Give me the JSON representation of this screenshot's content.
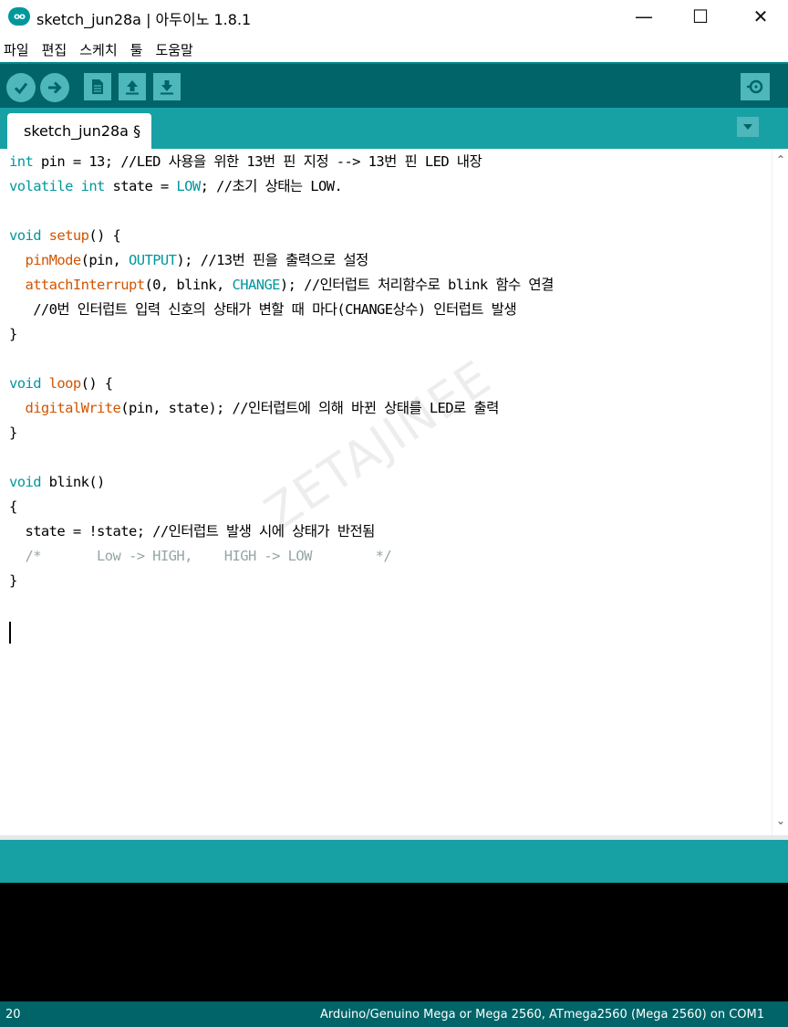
{
  "window": {
    "title": "sketch_jun28a | 아두이노 1.8.1",
    "minimize": "—",
    "maximize": "☐",
    "close": "✕",
    "logo_text": "oo"
  },
  "menu": [
    "파일",
    "편집",
    "스케치",
    "툴",
    "도움말"
  ],
  "toolbar": {
    "buttons": [
      "verify-icon",
      "upload-icon",
      "new-icon",
      "open-icon",
      "save-icon",
      "serial-monitor-icon"
    ]
  },
  "tab": {
    "label": "sketch_jun28a §"
  },
  "code": {
    "l1": {
      "a": "int",
      "b": " pin = 13; //LED 사용을 위한 13번 핀 지정 --> 13번 핀 LED 내장"
    },
    "l2": {
      "a": "volatile",
      "b": " ",
      "c": "int",
      "d": " state = ",
      "e": "LOW",
      "f": "; //초기 상태는 LOW."
    },
    "l4": {
      "a": "void",
      "b": " ",
      "c": "setup",
      "d": "() {"
    },
    "l5": {
      "a": "  ",
      "b": "pinMode",
      "c": "(pin, ",
      "d": "OUTPUT",
      "e": "); //13번 핀을 출력으로 설정"
    },
    "l6": {
      "a": "  ",
      "b": "attachInterrupt",
      "c": "(0, blink, ",
      "d": "CHANGE",
      "e": "); //인터럽트 처리함수로 blink 함수 연결"
    },
    "l7": {
      "a": "   //0번 인터럽트 입력 신호의 상태가 변할 때 마다(CHANGE상수) 인터럽트 발생"
    },
    "l8": {
      "a": "}"
    },
    "l10": {
      "a": "void",
      "b": " ",
      "c": "loop",
      "d": "() {"
    },
    "l11": {
      "a": "  ",
      "b": "digitalWrite",
      "c": "(pin, state); //인터럽트에 의해 바뀐 상태를 LED로 출력"
    },
    "l12": {
      "a": "}"
    },
    "l14": {
      "a": "void",
      "b": " blink()"
    },
    "l15": {
      "a": "{"
    },
    "l16": {
      "a": "  state = !state; //인터럽트 발생 시에 상태가 반전됨"
    },
    "l17": {
      "a": "  /*       Low -> HIGH,    HIGH -> LOW        */"
    },
    "l18": {
      "a": "}"
    }
  },
  "watermark": "ZETAJINEE",
  "scroll": {
    "up": "⌃",
    "down": "⌄"
  },
  "status": {
    "line": "20",
    "board": "Arduino/Genuino Mega or Mega 2560, ATmega2560 (Mega 2560) on COM1"
  },
  "colors": {
    "toolbar": "#006468",
    "tabrow": "#17a1a5",
    "button": "#4db7bb",
    "keyword": "#00979c",
    "function": "#d35400",
    "comment_block": "#95a5a6"
  }
}
